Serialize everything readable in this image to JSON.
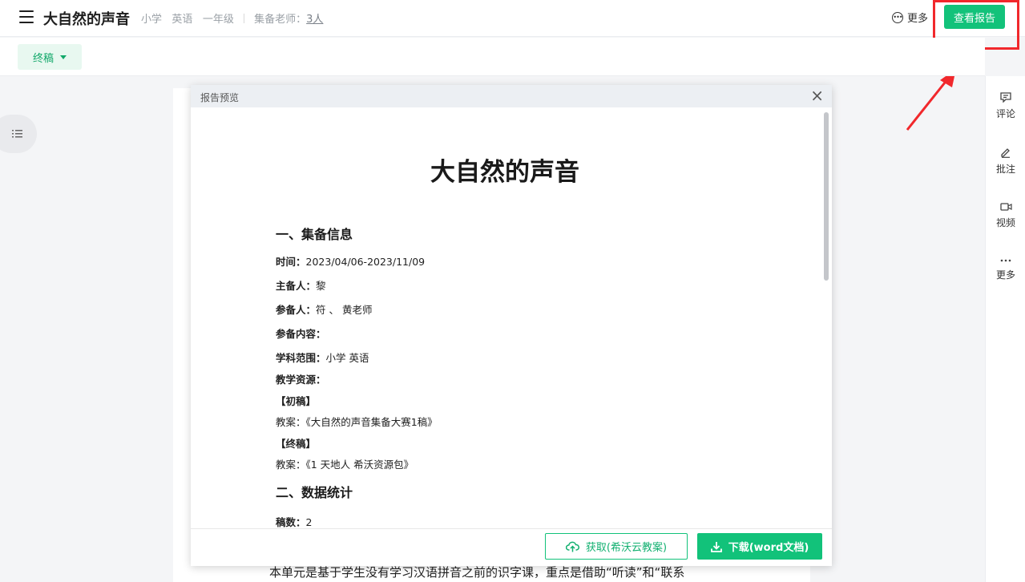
{
  "header": {
    "title": "大自然的声音",
    "stage": "小学",
    "subject": "英语",
    "grade": "一年级",
    "teachers_label": "集备老师：",
    "teachers_count": "3人",
    "more_label": "更多",
    "report_button": "查看报告"
  },
  "subbar": {
    "version_label": "终稿"
  },
  "sidebar_right": {
    "items": [
      {
        "label": "评论",
        "icon": "comment-icon"
      },
      {
        "label": "批注",
        "icon": "pen-icon"
      },
      {
        "label": "视频",
        "icon": "video-icon"
      },
      {
        "label": "更多",
        "icon": "ellipsis-icon"
      }
    ]
  },
  "document": {
    "visible_text": "本单元是基于学生没有学习汉语拼音之前的识字课，重点是借助“听读”和“联系"
  },
  "modal": {
    "title": "报告预览",
    "report_title": "大自然的声音",
    "section1": "一、集备信息",
    "time_label": "时间：",
    "time_value": "2023/04/06-2023/11/09",
    "host_label": "主备人：",
    "host_value": "黎",
    "participants_label": "参备人：",
    "participants_value": "符 、 黄老师",
    "content_label": "参备内容：",
    "scope_label": "学科范围：",
    "scope_value": "小学 英语",
    "resources_label": "教学资源：",
    "draft_label": "【初稿】",
    "draft_plan": "教案：《大自然的声音集备大赛1稿》",
    "final_label": "【终稿】",
    "final_plan": "教案：《1 天地人 希沃资源包》",
    "section2": "二、数据统计",
    "drafts_label": "稿数：",
    "drafts_value": "2",
    "obtain_button": "获取(希沃云教案)",
    "download_button": "下载(word文档)"
  },
  "colors": {
    "accent": "#12c27a",
    "highlight": "#f1282c"
  }
}
